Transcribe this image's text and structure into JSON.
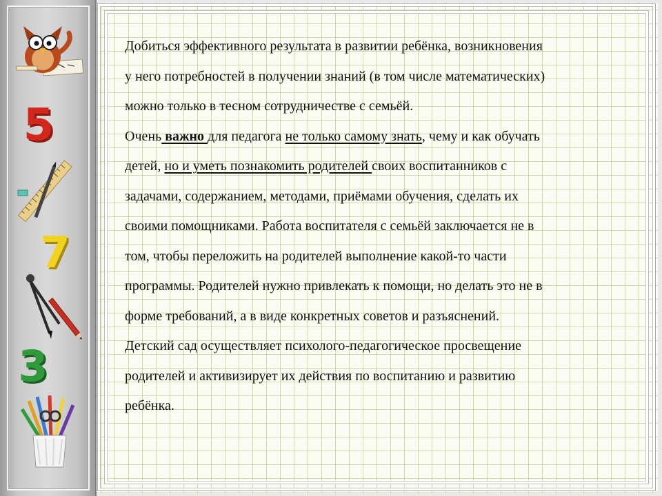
{
  "sidebar": {
    "decorations": [
      {
        "name": "owl-teacher-icon"
      },
      {
        "name": "digit-five-icon",
        "glyph": "5",
        "color": "#d2281c"
      },
      {
        "name": "ruler-pencil-icon"
      },
      {
        "name": "digit-seven-icon",
        "glyph": "7",
        "color": "#f2d21c"
      },
      {
        "name": "compass-icon"
      },
      {
        "name": "digit-three-icon",
        "glyph": "3",
        "color": "#2f9a3a"
      },
      {
        "name": "pencil-cup-icon"
      }
    ]
  },
  "content": {
    "lines": [
      [
        {
          "text": "Добиться эффективного результата в развитии ребёнка, возникновения"
        }
      ],
      [
        {
          "text": "у него потребностей в получении знаний (в том числе математических)"
        }
      ],
      [
        {
          "text": "можно только в тесном сотрудничестве с семьёй."
        }
      ],
      [
        {
          "text": "Очень"
        },
        {
          "text": " важно ",
          "bold": true,
          "underline": true
        },
        {
          "text": "для педагога "
        },
        {
          "text": "не только самому знать",
          "underline": true
        },
        {
          "text": ", чему и как обучать"
        }
      ],
      [
        {
          "text": "детей, "
        },
        {
          "text": "но и уметь познакомить родителей ",
          "underline": true
        },
        {
          "text": "своих воспитанников с"
        }
      ],
      [
        {
          "text": "задачами, содержанием, методами, приёмами обучения, сделать их"
        }
      ],
      [
        {
          "text": "своими помощниками. Работа воспитателя с семьёй заключается не в"
        }
      ],
      [
        {
          "text": "том, чтобы переложить на родителей выполнение какой-то части"
        }
      ],
      [
        {
          "text": "программы. Родителей нужно привлекать к помощи, но делать это не в"
        }
      ],
      [
        {
          "text": "форме требований, а в виде конкретных советов и разъяснений."
        }
      ],
      [
        {
          "text": "Детский сад осуществляет психолого-педагогическое просвещение"
        }
      ],
      [
        {
          "text": "родителей и активизирует их действия по воспитанию и развитию"
        }
      ],
      [
        {
          "text": "ребёнка."
        }
      ]
    ]
  }
}
